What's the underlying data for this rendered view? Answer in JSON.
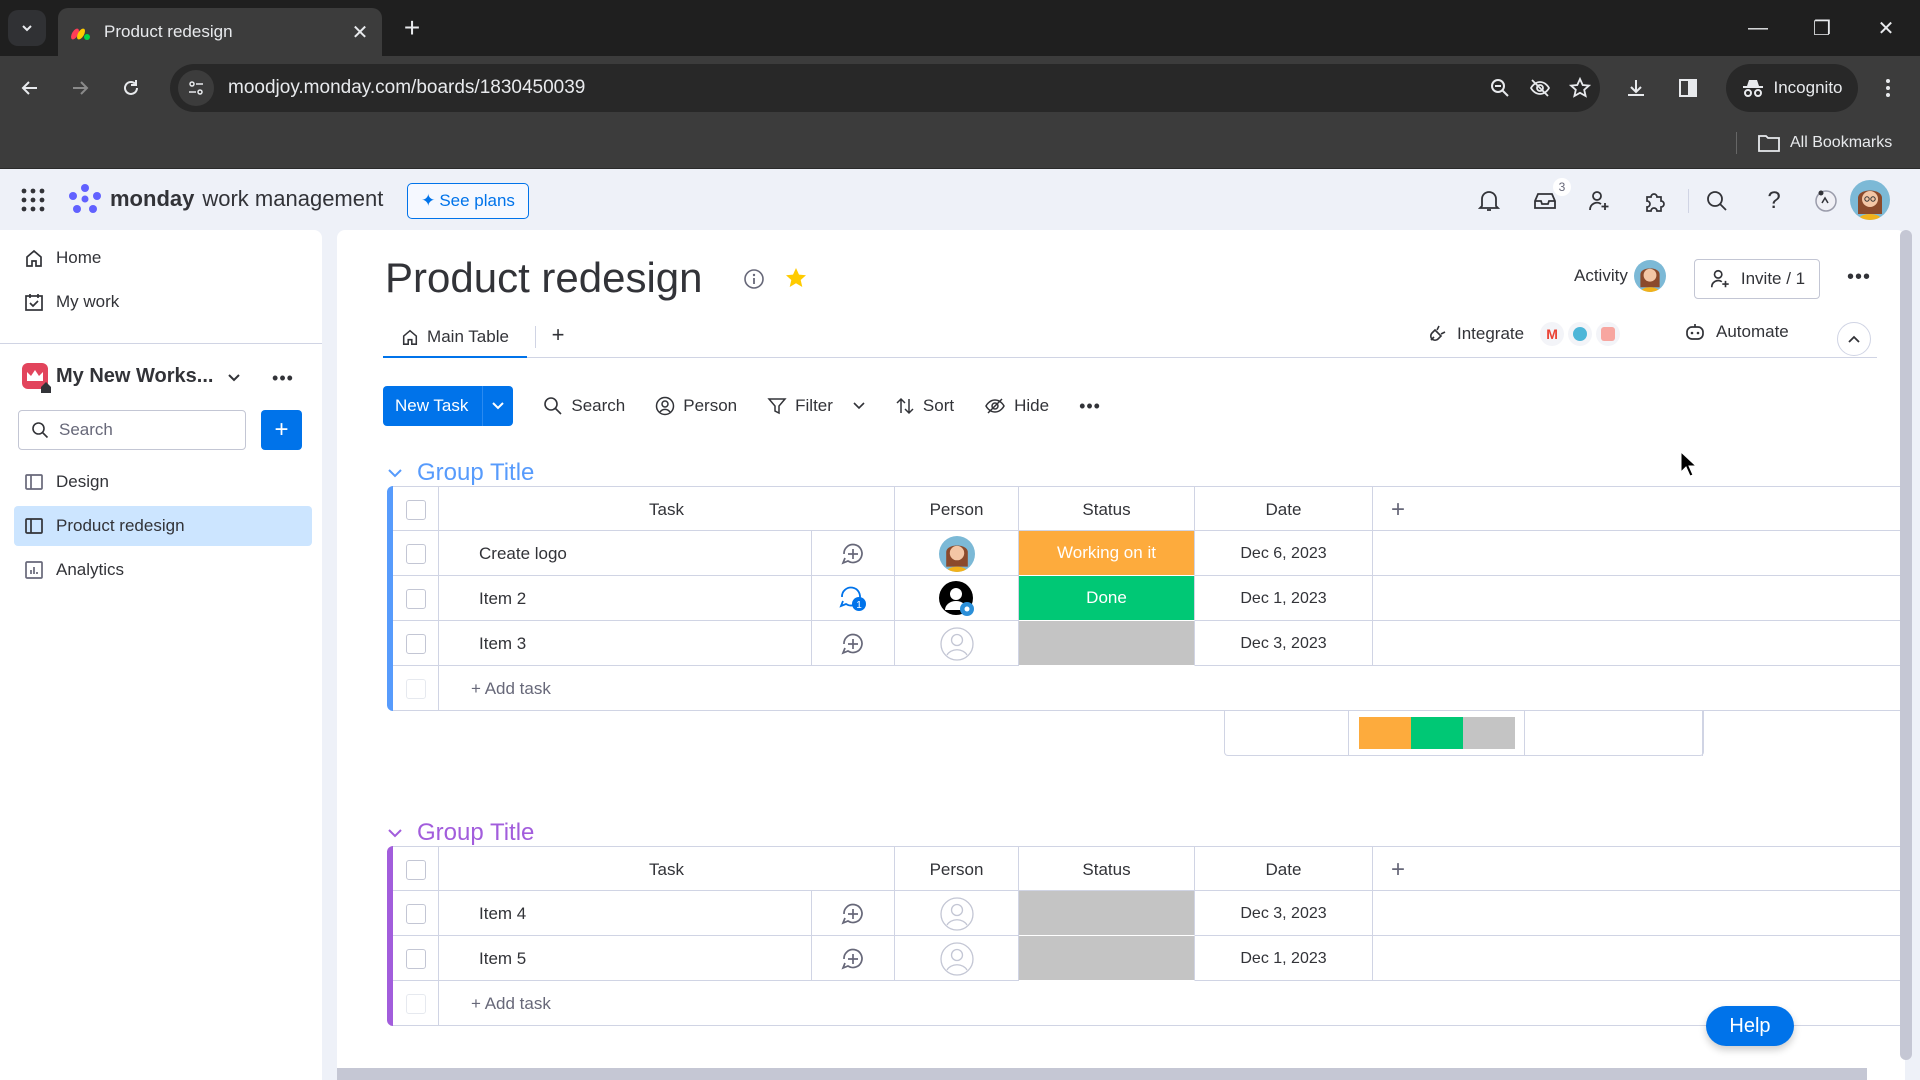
{
  "browser": {
    "tab_title": "Product redesign",
    "url": "moodjoy.monday.com/boards/1830450039",
    "profile_label": "Incognito",
    "bookmarks_label": "All Bookmarks"
  },
  "app": {
    "brand": "monday",
    "product": "work management",
    "see_plans_label": "See plans",
    "inbox_badge": "3"
  },
  "sidebar": {
    "nav": [
      {
        "label": "Home",
        "icon": "home-icon"
      },
      {
        "label": "My work",
        "icon": "calendar-check-icon"
      }
    ],
    "workspace_name": "My New Works...",
    "search_placeholder": "Search",
    "boards": [
      {
        "label": "Design",
        "icon": "board-icon",
        "active": false
      },
      {
        "label": "Product redesign",
        "icon": "board-icon",
        "active": true
      },
      {
        "label": "Analytics",
        "icon": "dashboard-icon",
        "active": false
      }
    ]
  },
  "board": {
    "title": "Product redesign",
    "activity_label": "Activity",
    "invite_label": "Invite / 1",
    "views": [
      {
        "label": "Main Table"
      }
    ],
    "integrate_label": "Integrate",
    "automate_label": "Automate",
    "toolbar": {
      "new_task": "New Task",
      "search": "Search",
      "person": "Person",
      "filter": "Filter",
      "sort": "Sort",
      "hide": "Hide"
    },
    "columns": {
      "task": "Task",
      "person": "Person",
      "status": "Status",
      "date": "Date"
    },
    "add_task_label": "+ Add task",
    "colors": {
      "working": "#fdab3d",
      "done": "#00c875",
      "empty": "#c4c4c4",
      "group1": "#579bfc",
      "group2": "#a25ddc",
      "accent": "#0073ea"
    },
    "groups": [
      {
        "title": "Group Title",
        "color": "#579bfc",
        "rows": [
          {
            "task": "Create logo",
            "person": "avatar",
            "status": "Working on it",
            "status_color": "#fdab3d",
            "date": "Dec 6, 2023",
            "updates": ""
          },
          {
            "task": "Item 2",
            "person": "viewer",
            "status": "Done",
            "status_color": "#00c875",
            "date": "Dec 1, 2023",
            "updates": "1"
          },
          {
            "task": "Item 3",
            "person": "empty",
            "status": "",
            "status_color": "#c4c4c4",
            "date": "Dec 3, 2023",
            "updates": ""
          }
        ],
        "status_summary": [
          {
            "label": "Working on it",
            "fraction": 0.3333,
            "color": "#fdab3d"
          },
          {
            "label": "Done",
            "fraction": 0.3333,
            "color": "#00c875"
          },
          {
            "label": "",
            "fraction": 0.3334,
            "color": "#c4c4c4"
          }
        ]
      },
      {
        "title": "Group Title",
        "color": "#a25ddc",
        "rows": [
          {
            "task": "Item 4",
            "person": "empty",
            "status": "",
            "status_color": "#c4c4c4",
            "date": "Dec 3, 2023",
            "updates": ""
          },
          {
            "task": "Item 5",
            "person": "empty",
            "status": "",
            "status_color": "#c4c4c4",
            "date": "Dec 1, 2023",
            "updates": ""
          }
        ]
      }
    ]
  },
  "help_label": "Help"
}
